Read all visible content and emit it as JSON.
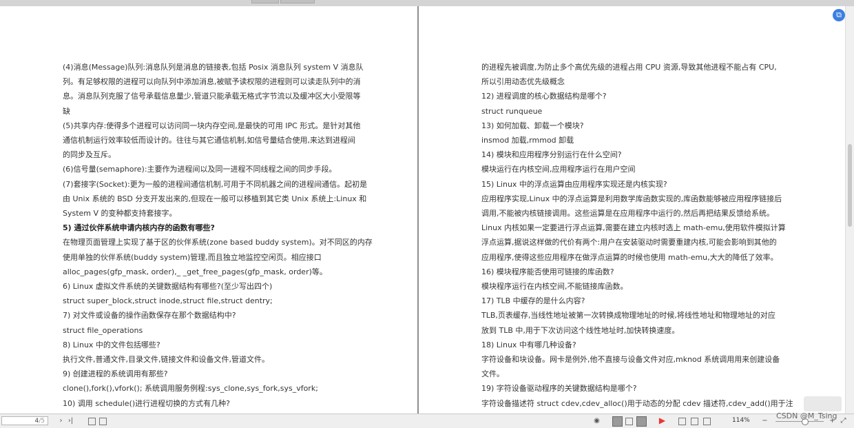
{
  "left_page": {
    "lines": [
      {
        "text": "(4)消息(Message)队列:消息队列是消息的链接表,包括 Posix 消息队列 system V 消息队",
        "bold": false
      },
      {
        "text": "列。有足够权限的进程可以向队列中添加消息,被赋予读权限的进程则可以读走队列中的消",
        "bold": false
      },
      {
        "text": "息。消息队列克服了信号承载信息量少,管道只能承载无格式字节流以及缓冲区大小受限等",
        "bold": false
      },
      {
        "text": "缺",
        "bold": false
      },
      {
        "text": "(5)共享内存:使得多个进程可以访问同一块内存空间,是最快的可用 IPC 形式。是针对其他",
        "bold": false
      },
      {
        "text": "通信机制运行效率较低而设计的。往往与其它通信机制,如信号量结合使用,来达到进程间",
        "bold": false
      },
      {
        "text": "的同步及互斥。",
        "bold": false
      },
      {
        "text": "(6)信号量(semaphore):主要作为进程间以及同一进程不同线程之间的同步手段。",
        "bold": false
      },
      {
        "text": "(7)套接字(Socket):更为一般的进程间通信机制,可用于不同机器之间的进程间通信。起初是",
        "bold": false
      },
      {
        "text": "由 Unix 系统的 BSD 分支开发出来的,但现在一般可以移植到其它类 Unix 系统上:Linux 和",
        "bold": false
      },
      {
        "text": "System V 的变种都支持套接字。",
        "bold": false
      },
      {
        "text": "5) 通过伙伴系统申请内核内存的函数有哪些?",
        "bold": true
      },
      {
        "text": "在物理页面管理上实现了基于区的伙伴系统(zone based buddy system)。对不同区的内存",
        "bold": false
      },
      {
        "text": "使用单独的伙伴系统(buddy system)管理,而且独立地监控空闲页。相应接口",
        "bold": false
      },
      {
        "text": "alloc_pages(gfp_mask, order),_ _get_free_pages(gfp_mask, order)等。",
        "bold": false
      },
      {
        "text": "6) Linux 虚拟文件系统的关键数据结构有哪些?(至少写出四个)",
        "bold": false
      },
      {
        "text": "struct super_block,struct inode,struct file,struct dentry;",
        "bold": false
      },
      {
        "text": "7) 对文件或设备的操作函数保存在那个数据结构中?",
        "bold": false
      },
      {
        "text": "struct file_operations",
        "bold": false
      },
      {
        "text": "8) Linux 中的文件包括哪些?",
        "bold": false
      },
      {
        "text": "执行文件,普通文件,目录文件,链接文件和设备文件,管道文件。",
        "bold": false
      },
      {
        "text": "9) 创建进程的系统调用有那些?",
        "bold": false
      },
      {
        "text": "clone(),fork(),vfork(); 系统调用服务例程:sys_clone,sys_fork,sys_vfork;",
        "bold": false
      },
      {
        "text": "10) 调用 schedule()进行进程切换的方式有几种?",
        "bold": false
      }
    ]
  },
  "right_page": {
    "lines": [
      {
        "text": "的进程先被调度,为防止多个高优先级的进程占用 CPU 资源,导致其他进程不能占有 CPU,",
        "bold": false
      },
      {
        "text": "所以引用动态优先级概念",
        "bold": false
      },
      {
        "text": "12) 进程调度的核心数据结构是哪个?",
        "bold": false
      },
      {
        "text": "struct runqueue",
        "bold": false
      },
      {
        "text": "13) 如何加载、卸载一个模块?",
        "bold": false
      },
      {
        "text": "insmod 加载,rmmod 卸载",
        "bold": false
      },
      {
        "text": "14) 模块和应用程序分别运行在什么空间?",
        "bold": false
      },
      {
        "text": "模块运行在内核空间,应用程序运行在用户空间",
        "bold": false
      },
      {
        "text": "15) Linux 中的浮点运算由应用程序实现还是内核实现?",
        "bold": false
      },
      {
        "text": "应用程序实现,Linux 中的浮点运算是利用数学库函数实现的,库函数能够被应用程序链接后",
        "bold": false
      },
      {
        "text": "调用,不能被内核链接调用。这些运算是在应用程序中运行的,然后再把结果反馈给系统。",
        "bold": false
      },
      {
        "text": "Linux 内核如果一定要进行浮点运算,需要在建立内核时选上 math-emu,使用软件模拟计算",
        "bold": false
      },
      {
        "text": "浮点运算,据说这样做的代价有两个:用户在安装驱动时需要重建内核,可能会影响到其他的",
        "bold": false
      },
      {
        "text": "应用程序,使得这些应用程序在做浮点运算的时候也使用 math-emu,大大的降低了效率。",
        "bold": false
      },
      {
        "text": "16) 模块程序能否使用可链接的库函数?",
        "bold": false
      },
      {
        "text": "模块程序运行在内核空间,不能链接库函数。",
        "bold": false
      },
      {
        "text": "17) TLB 中缓存的是什么内容?",
        "bold": false
      },
      {
        "text": "TLB,页表缓存,当线性地址被第一次转换成物理地址的时候,将线性地址和物理地址的对应",
        "bold": false
      },
      {
        "text": "放到 TLB 中,用于下次访问这个线性地址时,加快转换速度。",
        "bold": false
      },
      {
        "text": "18) Linux 中有哪几种设备?",
        "bold": false
      },
      {
        "text": "字符设备和块设备。网卡是例外,他不直接与设备文件对应,mknod 系统调用用来创建设备",
        "bold": false
      },
      {
        "text": "文件。",
        "bold": false
      },
      {
        "text": "19) 字符设备驱动程序的关键数据结构是哪个?",
        "bold": false
      },
      {
        "text": "字符设备描述符 struct cdev,cdev_alloc()用于动态的分配 cdev 描述符,cdev_add()用于注",
        "bold": false
      }
    ]
  },
  "statusbar": {
    "current_page": "4",
    "total_pages": "/5",
    "zoom": "114%",
    "icons": [
      "first-page-icon",
      "prev-page-icon",
      "next-page-icon",
      "last-page-icon",
      "add-page-icon",
      "doc-icon",
      "eye-icon",
      "single-page-view-icon",
      "continuous-view-icon",
      "two-page-view-icon",
      "play-icon",
      "fit-width-icon",
      "fit-page-icon",
      "rotate-icon"
    ]
  },
  "watermark": "CSDN @M_Tsing"
}
